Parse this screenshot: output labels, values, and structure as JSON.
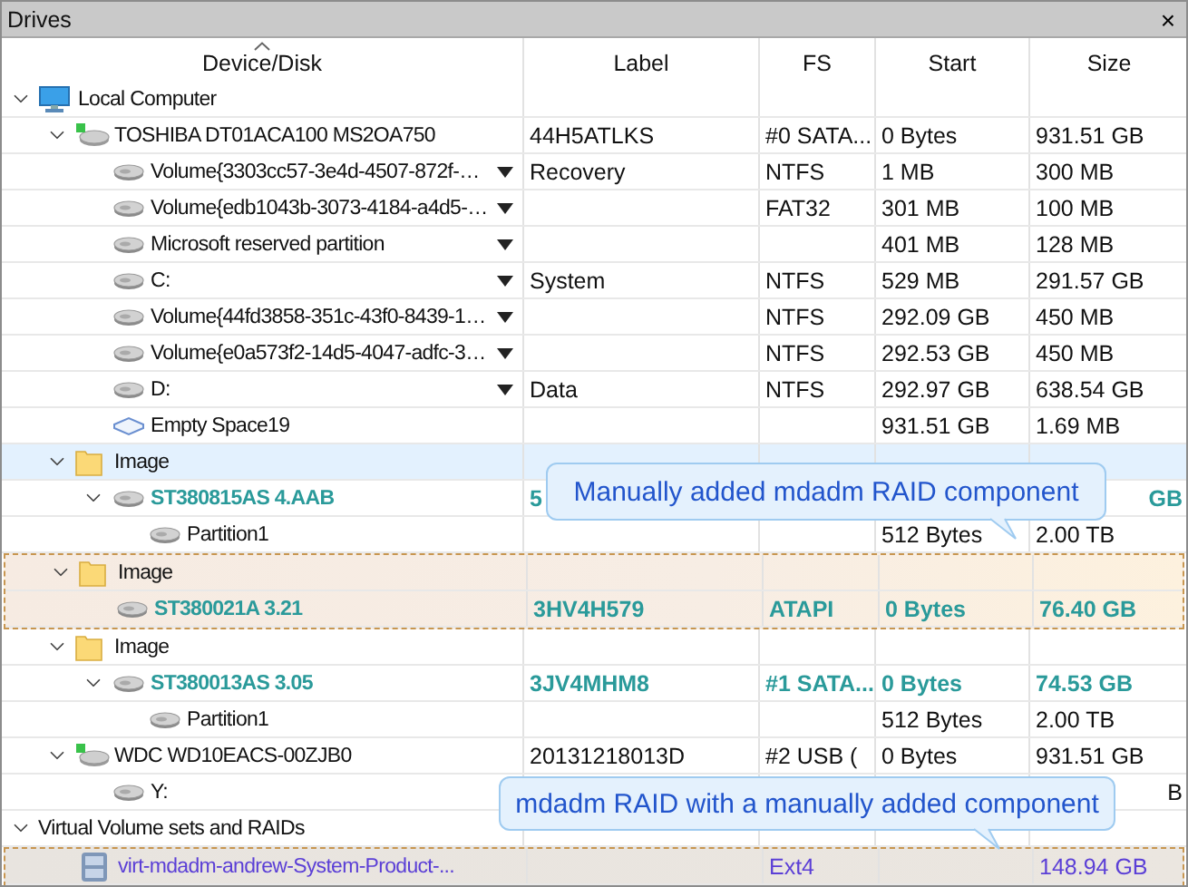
{
  "panel": {
    "title": "Drives",
    "close": "×"
  },
  "columns": [
    "Device/Disk",
    "Label",
    "FS",
    "Start",
    "Size"
  ],
  "tree": [
    {
      "kind": "computer",
      "name": "Local Computer",
      "expanded": true,
      "children": [
        {
          "kind": "drive",
          "name": "TOSHIBA DT01ACA100 MS2OA750",
          "expanded": true,
          "cells": {
            "label": "44H5ATLKS",
            "fs": "#0 SATA...",
            "start": "0 Bytes",
            "size": "931.51 GB"
          },
          "children": [
            {
              "kind": "volume",
              "name": "Volume{3303cc57-3e4d-4507-872f-…",
              "menu": true,
              "cells": {
                "label": "Recovery",
                "fs": "NTFS",
                "start": "1 MB",
                "size": "300 MB"
              }
            },
            {
              "kind": "volume",
              "name": "Volume{edb1043b-3073-4184-a4d5-…",
              "menu": true,
              "cells": {
                "fs": "FAT32",
                "start": "301 MB",
                "size": "100 MB"
              }
            },
            {
              "kind": "volume",
              "name": "Microsoft reserved partition",
              "menu": true,
              "cells": {
                "start": "401 MB",
                "size": "128 MB"
              }
            },
            {
              "kind": "volume",
              "name": "C:",
              "menu": true,
              "cells": {
                "label": "System",
                "fs": "NTFS",
                "start": "529 MB",
                "size": "291.57 GB"
              }
            },
            {
              "kind": "volume",
              "name": "Volume{44fd3858-351c-43f0-8439-1…",
              "menu": true,
              "cells": {
                "fs": "NTFS",
                "start": "292.09 GB",
                "size": "450 MB"
              }
            },
            {
              "kind": "volume",
              "name": "Volume{e0a573f2-14d5-4047-adfc-3…",
              "menu": true,
              "cells": {
                "fs": "NTFS",
                "start": "292.53 GB",
                "size": "450 MB"
              }
            },
            {
              "kind": "volume",
              "name": "D:",
              "menu": true,
              "cells": {
                "label": "Data",
                "fs": "NTFS",
                "start": "292.97 GB",
                "size": "638.54 GB"
              }
            },
            {
              "kind": "empty",
              "name": "Empty Space19",
              "cells": {
                "start": "931.51 GB",
                "size": "1.69 MB"
              }
            }
          ]
        },
        {
          "kind": "folder",
          "name": "Image",
          "expanded": true,
          "selected": true,
          "children": [
            {
              "kind": "disk",
              "name": "ST380815AS 4.AAB",
              "color": "#2a9a9a",
              "bold": true,
              "expanded": true,
              "cells": {
                "label": "5",
                "size": "GB"
              },
              "children": [
                {
                  "kind": "volume",
                  "name": "Partition1",
                  "cells": {
                    "start": "512 Bytes",
                    "size": "2.00 TB"
                  }
                }
              ]
            }
          ]
        },
        {
          "kind": "folder",
          "name": "Image",
          "expanded": true,
          "selected": false,
          "outlined": true,
          "children": [
            {
              "kind": "disk",
              "name": "ST380021A 3.21",
              "color": "#2a9a9a",
              "bold": true,
              "outlined": true,
              "cells": {
                "label": "3HV4H579",
                "fs": "ATAPI",
                "start": "0 Bytes",
                "size": "76.40 GB"
              }
            }
          ]
        },
        {
          "kind": "folder",
          "name": "Image",
          "expanded": true,
          "selected": false,
          "children": [
            {
              "kind": "disk",
              "name": "ST380013AS 3.05",
              "color": "#2a9a9a",
              "bold": true,
              "expanded": true,
              "cells": {
                "label": "3JV4MHM8",
                "fs": "#1 SATA...",
                "start": "0 Bytes",
                "size": "74.53 GB"
              },
              "children": [
                {
                  "kind": "volume",
                  "name": "Partition1",
                  "cells": {
                    "start": "512 Bytes",
                    "size": "2.00 TB"
                  }
                }
              ]
            }
          ]
        },
        {
          "kind": "drive",
          "name": "WDC WD10EACS-00ZJB0",
          "expanded": true,
          "cells": {
            "label": "20131218013D",
            "fs": "#2 USB (",
            "start": "0 Bytes",
            "size": "931.51 GB"
          },
          "children": [
            {
              "kind": "volume",
              "name": "Y:",
              "cells": {
                "size": "B"
              }
            }
          ]
        }
      ]
    },
    {
      "kind": "section",
      "name": "Virtual Volume sets and RAIDs",
      "expanded": true,
      "children": [
        {
          "kind": "raid",
          "name": "virt-mdadm-andrew-System-Product-...",
          "color": "#5b3fd6",
          "outlined": true,
          "cells": {
            "fs": "Ext4",
            "size": "148.94 GB"
          }
        }
      ]
    }
  ],
  "callouts": [
    {
      "text": "Manually added mdadm RAID component"
    },
    {
      "text": "mdadm RAID with a manually added component"
    }
  ]
}
